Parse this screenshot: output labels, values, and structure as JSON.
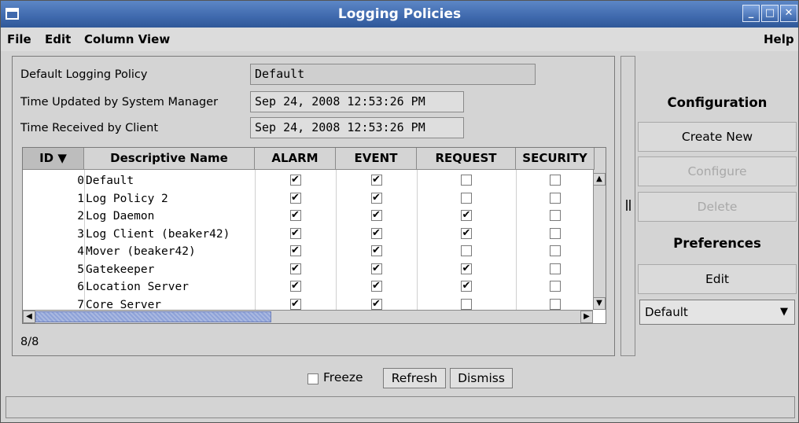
{
  "window": {
    "title": "Logging Policies"
  },
  "menu": {
    "file": "File",
    "edit": "Edit",
    "column_view": "Column View",
    "help": "Help"
  },
  "form": {
    "default_policy_label": "Default Logging Policy",
    "default_policy_value": "Default",
    "time_updated_label": "Time Updated by System Manager",
    "time_updated_value": "Sep 24, 2008 12:53:26 PM",
    "time_received_label": "Time Received by Client",
    "time_received_value": "Sep 24, 2008 12:53:26 PM"
  },
  "table": {
    "columns": [
      "ID ▼",
      "Descriptive Name",
      "ALARM",
      "EVENT",
      "REQUEST",
      "SECURITY"
    ],
    "rows": [
      {
        "id": "0",
        "name": "Default",
        "alarm": true,
        "event": true,
        "request": false,
        "security": false
      },
      {
        "id": "1",
        "name": "Log Policy 2",
        "alarm": true,
        "event": true,
        "request": false,
        "security": false
      },
      {
        "id": "2",
        "name": "Log Daemon",
        "alarm": true,
        "event": true,
        "request": true,
        "security": false
      },
      {
        "id": "3",
        "name": "Log Client (beaker42)",
        "alarm": true,
        "event": true,
        "request": true,
        "security": false
      },
      {
        "id": "4",
        "name": "Mover (beaker42)",
        "alarm": true,
        "event": true,
        "request": false,
        "security": false
      },
      {
        "id": "5",
        "name": "Gatekeeper",
        "alarm": true,
        "event": true,
        "request": true,
        "security": false
      },
      {
        "id": "6",
        "name": "Location Server",
        "alarm": true,
        "event": true,
        "request": true,
        "security": false
      },
      {
        "id": "7",
        "name": "Core Server",
        "alarm": true,
        "event": true,
        "request": false,
        "security": false
      }
    ],
    "count": "8/8"
  },
  "side": {
    "configuration_heading": "Configuration",
    "create_new": "Create New",
    "configure": "Configure",
    "delete": "Delete",
    "preferences_heading": "Preferences",
    "edit": "Edit",
    "preference_select": "Default"
  },
  "bottom": {
    "freeze": "Freeze",
    "refresh": "Refresh",
    "dismiss": "Dismiss"
  }
}
